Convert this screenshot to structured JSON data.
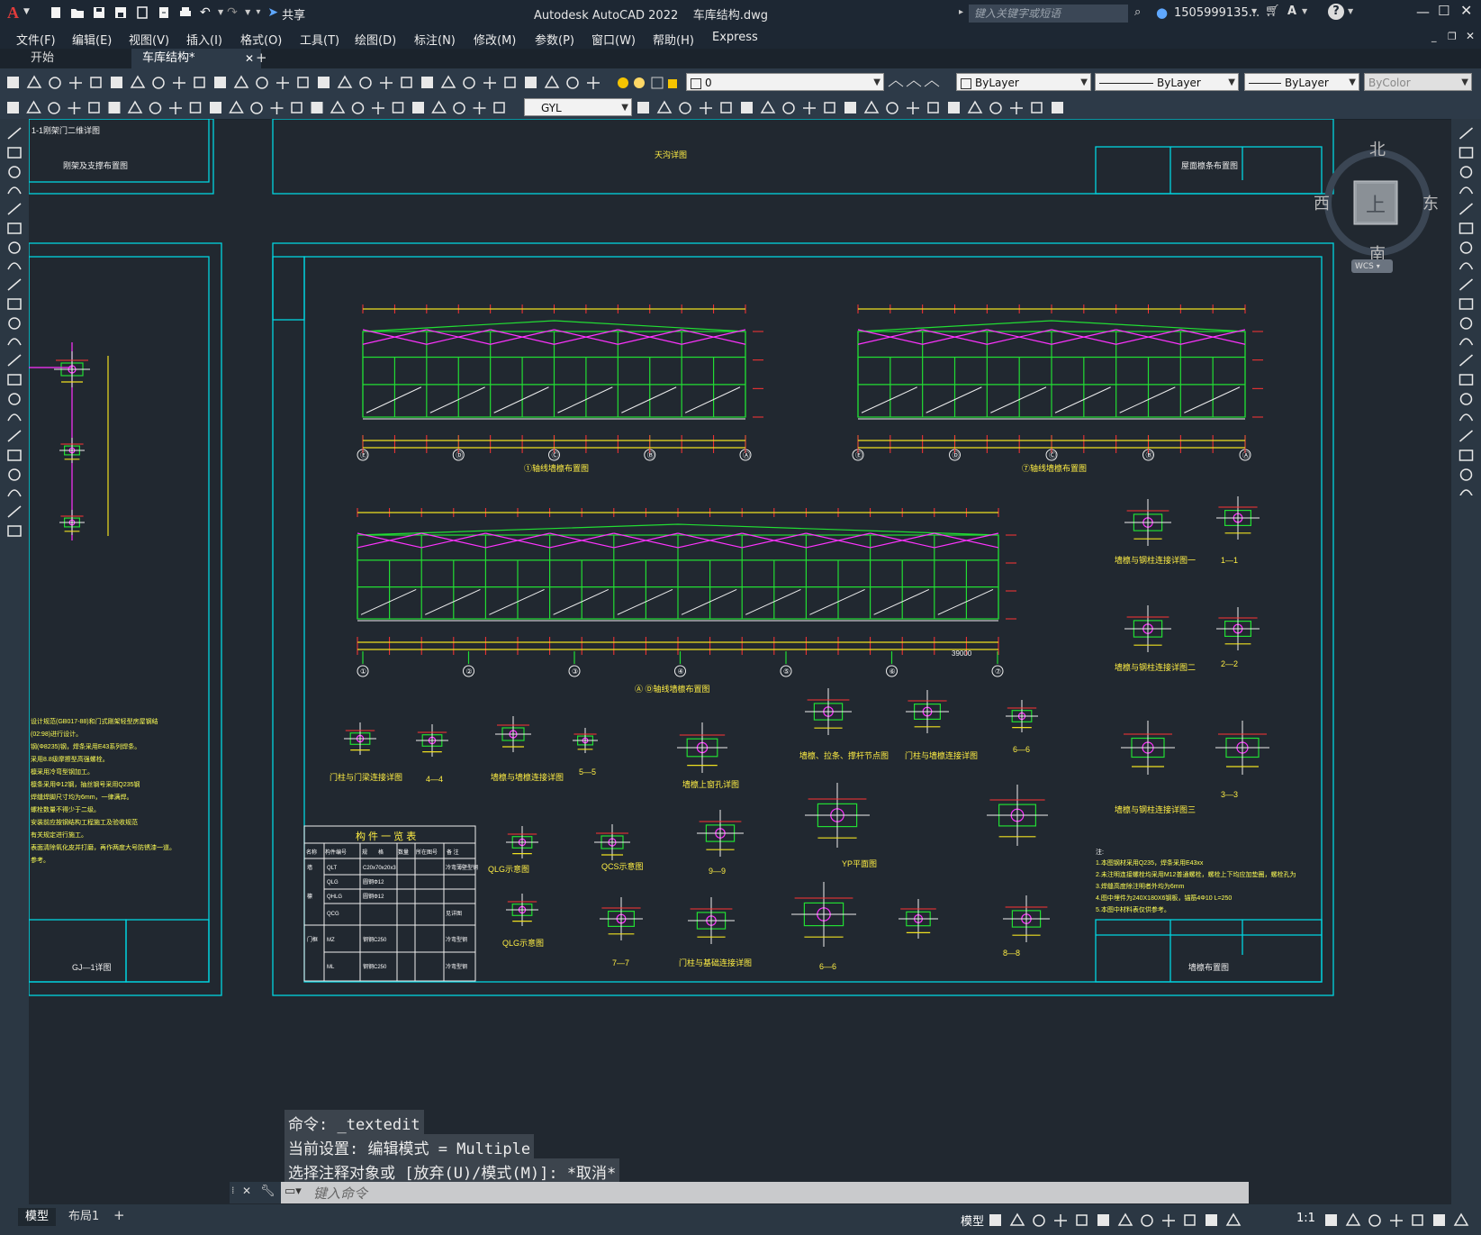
{
  "app": {
    "title": "Autodesk AutoCAD 2022",
    "filename": "车库结构.dwg",
    "search_placeholder": "键入关键字或短语",
    "user": "1505999135...",
    "share_label": "共享"
  },
  "menu": [
    "文件(F)",
    "编辑(E)",
    "视图(V)",
    "插入(I)",
    "格式(O)",
    "工具(T)",
    "绘图(D)",
    "标注(N)",
    "修改(M)",
    "参数(P)",
    "窗口(W)",
    "帮助(H)",
    "Express"
  ],
  "tabs": [
    {
      "label": "开始",
      "active": false
    },
    {
      "label": "车库结构*",
      "active": true
    }
  ],
  "toolbar": {
    "layer_value": "0",
    "color_value": "ByLayer",
    "linetype_value": "ByLayer",
    "lineweight_value": "ByLayer",
    "plotstyle_value": "ByColor",
    "textstyle_value": "GYL"
  },
  "viewcube": {
    "north": "北",
    "south": "南",
    "east": "东",
    "west": "西",
    "top": "上",
    "wcs": "WCS"
  },
  "command": {
    "line1": "命令: _textedit",
    "line2": "当前设置: 编辑模式 = Multiple",
    "line3": "选择注释对象或 [放弃(U)/模式(M)]: *取消*",
    "placeholder": "键入命令"
  },
  "layout_tabs": [
    "模型",
    "布局1"
  ],
  "status": {
    "model_label": "模型",
    "scale": "1:1"
  },
  "drawing": {
    "titles": {
      "elev_a": "①轴线墙檩布置图",
      "elev_b": "⑦轴线墙檩布置图",
      "elev_c": "Ⓐ Ⓓ轴线墙檩布置图",
      "detail1": "墙檩与钢柱连接详图一",
      "detail2": "墙檩与钢柱连接详图二",
      "detail3": "墙檩与钢柱连接详图三",
      "sec11": "1—1",
      "sec22": "2—2",
      "sec33": "3—3",
      "door1": "门柱与门梁连接详图",
      "sec44": "4—4",
      "purlin": "墙檩与墙檩连接详图",
      "sec55": "5—5",
      "window": "墙檩上窗孔详图",
      "brace": "墙檩、拉条、撑杆节点图",
      "doorbeam": "门柱与墙檩连接详图",
      "sec66": "6—6",
      "sec77": "7—7",
      "sec88": "8—8",
      "sec99": "9—9",
      "found": "门柱与基础连接详图",
      "ylp": "YP平面图",
      "qlg": "QLG示意图",
      "qcs": "QCS示意图",
      "qlg2": "QLG示意图",
      "table_title": "构 件 一 览 表",
      "sheet_title": "墙檩布置图",
      "top_sheet": "屋面檩条布置图",
      "top_left_sheet": "刚架及支撑布置图",
      "left_sheet": "GJ—1详图",
      "tianchuang": "天沟详图",
      "top_label": "1-1刚架门二维详图"
    },
    "table_headers": [
      "名称",
      "构件编号",
      "规",
      "格",
      "数量",
      "所在图号",
      "备 注"
    ],
    "table_rows": [
      [
        "墙",
        "QLT",
        "C20x70x20x3",
        "",
        "",
        "",
        "冷弯薄壁型钢"
      ],
      [
        "",
        "QLG",
        "圆钢Φ12",
        "",
        "",
        "",
        ""
      ],
      [
        "檩",
        "QHLG",
        "圆钢Φ12",
        "",
        "",
        "",
        ""
      ],
      [
        "",
        "QCG",
        "",
        "",
        "",
        "",
        "见详图"
      ],
      [
        "门框",
        "MZ",
        "钢钢C250",
        "",
        "",
        "",
        "冷弯型钢"
      ],
      [
        "",
        "ML",
        "钢钢C250",
        "",
        "",
        "",
        "冷弯型钢"
      ]
    ],
    "notes_title": "注:",
    "notes": [
      "1.本图钢材采用Q235，焊条采用E43xx",
      "2.未注明连接螺栓均采用M12普通螺栓，螺栓上下均应加垫圈，螺栓孔为",
      "3.焊缝高度除注明者外均为6mm",
      "4.图中埋件为240X180X6钢板，锚筋4Φ10 L=250",
      "5.本图中材料表仅供参考。"
    ],
    "left_notes": [
      "设计规范(GB017-88)和门式刚架轻型房屋钢结",
      "(02:98)进行设计。",
      "钢(Φ8235)钢，焊条采用E43系列焊条。",
      "采用8.8级摩擦型高强螺栓。",
      "檩采用冷弯型钢加工。",
      "檩条采用Φ12钢，抽丝钢号采用Q235钢",
      "焊缝焊脚尺寸均为6mm，一律满焊。",
      "螺栓数量不得少于二级。",
      "安装前应按钢结构工程施工及验收规范",
      "有关规定进行施工。",
      "表面清除氧化皮并打磨，再作两度大号防锈漆一道。",
      "参考。"
    ],
    "axis_a": [
      "Ⓔ",
      "Ⓓ",
      "Ⓒ",
      "Ⓑ",
      "Ⓐ"
    ],
    "axis_c": [
      "①",
      "②",
      "③",
      "④",
      "⑤",
      "⑥",
      "⑦"
    ],
    "dim_total": "39000"
  }
}
